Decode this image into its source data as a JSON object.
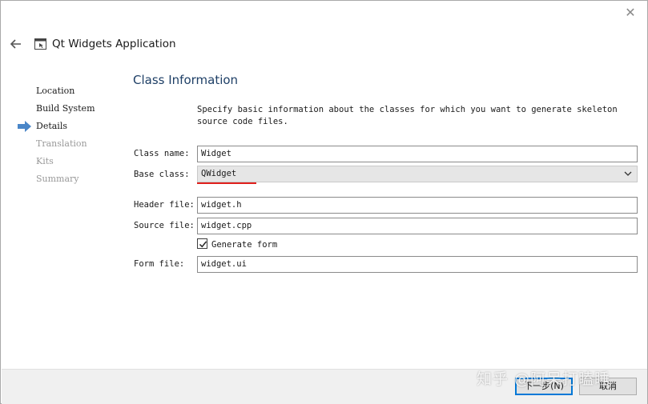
{
  "window": {
    "close_glyph": "✕"
  },
  "header": {
    "title": "Qt Widgets Application",
    "back_icon": "arrow-left-icon",
    "app_icon": "window-icon"
  },
  "steps": [
    {
      "label": "Location",
      "state": "done"
    },
    {
      "label": "Build System",
      "state": "done"
    },
    {
      "label": "Details",
      "state": "current"
    },
    {
      "label": "Translation",
      "state": "disabled"
    },
    {
      "label": "Kits",
      "state": "disabled"
    },
    {
      "label": "Summary",
      "state": "disabled"
    }
  ],
  "page": {
    "title": "Class Information",
    "description": "Specify basic information about the classes for which you want to generate skeleton source code files."
  },
  "form": {
    "class_name": {
      "label": "Class name:",
      "value": "Widget"
    },
    "base_class": {
      "label": "Base class:",
      "value": "QWidget"
    },
    "header_file": {
      "label": "Header file:",
      "value": "widget.h"
    },
    "source_file": {
      "label": "Source file:",
      "value": "widget.cpp"
    },
    "generate_form": {
      "label": "Generate form",
      "checked": true
    },
    "form_file": {
      "label": "Form file:",
      "value": "widget.ui"
    }
  },
  "footer": {
    "next_label": "下一步(N)",
    "cancel_label": "取消",
    "watermark": "知乎 @阿呆打瞌睡"
  },
  "colors": {
    "accent": "#1e3f66",
    "highlight_underline": "#e0201c",
    "step_arrow": "#4a86c8"
  }
}
